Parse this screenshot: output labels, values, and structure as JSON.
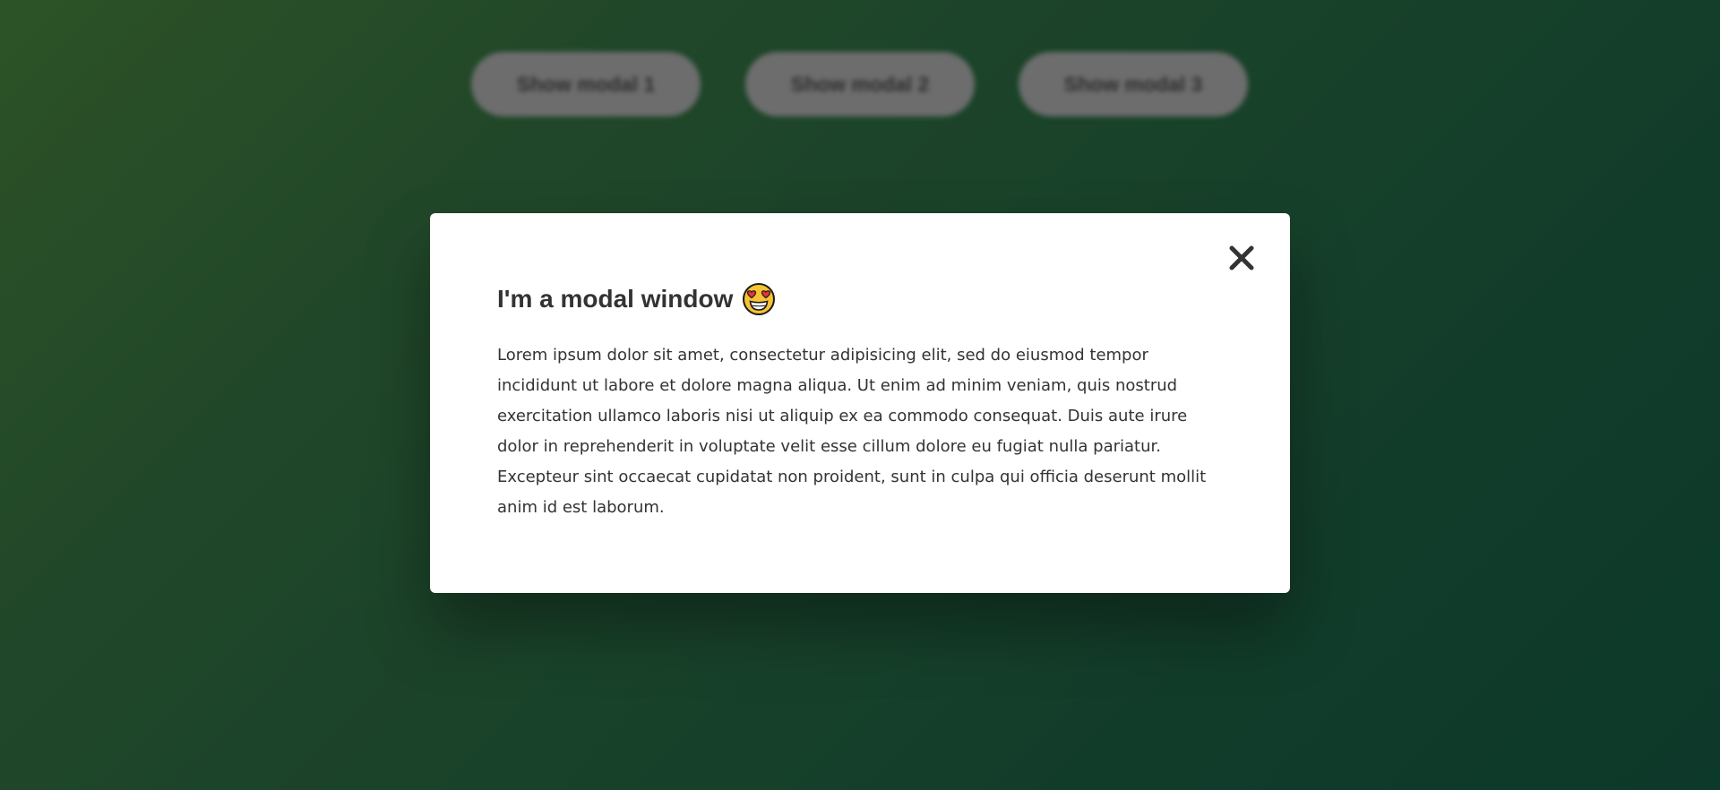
{
  "background": {
    "buttons": [
      {
        "label": "Show modal 1"
      },
      {
        "label": "Show modal 2"
      },
      {
        "label": "Show modal 3"
      }
    ]
  },
  "modal": {
    "title": "I'm a modal window",
    "title_icon": "heart-eyes-emoji-icon",
    "body": "Lorem ipsum dolor sit amet, consectetur adipisicing elit, sed do eiusmod tempor incididunt ut labore et dolore magna aliqua. Ut enim ad minim veniam, quis nostrud exercitation ullamco laboris nisi ut aliquip ex ea commodo consequat. Duis aute irure dolor in reprehenderit in voluptate velit esse cillum dolore eu fugiat nulla pariatur. Excepteur sint occaecat cupidatat non proident, sunt in culpa qui officia deserunt mollit anim id est laborum.",
    "close_icon": "close-icon"
  },
  "colors": {
    "background_start": "#3a6a32",
    "background_end": "#114a37",
    "modal_bg": "#ffffff",
    "text": "#333333"
  }
}
